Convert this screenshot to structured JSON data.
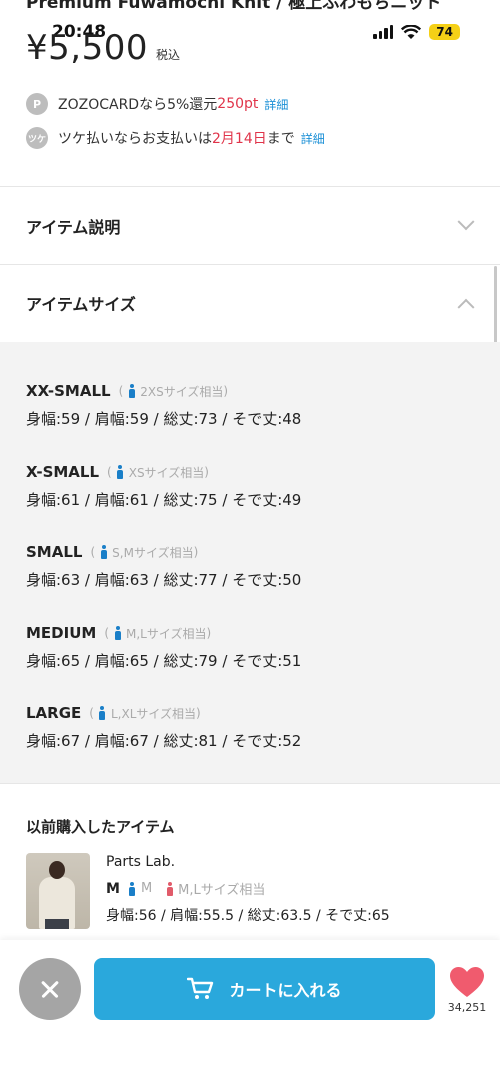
{
  "status_bar": {
    "time": "20:48",
    "battery": "74"
  },
  "product": {
    "title_cut": "Premium Fuwamochi Knit / 極上ふわもちニット",
    "price": "¥5,500",
    "tax_label": "税込"
  },
  "promos": [
    {
      "icon": "P",
      "text_pre": "ZOZOCARDなら5%還元 ",
      "highlight": "250pt",
      "text_post": "",
      "link": "詳細"
    },
    {
      "icon": "ツケ",
      "text_pre": "ツケ払いならお支払いは",
      "highlight": "2月14日",
      "text_post": "まで",
      "link": "詳細"
    }
  ],
  "accordions": {
    "description": "アイテム説明",
    "sizes": "アイテムサイズ"
  },
  "sizes": [
    {
      "name": "XX-SMALL",
      "note": "2XSサイズ相当",
      "dims": "身幅:59 / 肩幅:59 / 総丈:73 / そで丈:48"
    },
    {
      "name": "X-SMALL",
      "note": "XSサイズ相当",
      "dims": "身幅:61 / 肩幅:61 / 総丈:75 / そで丈:49"
    },
    {
      "name": "SMALL",
      "note": "S,Mサイズ相当",
      "dims": "身幅:63 / 肩幅:63 / 総丈:77 / そで丈:50"
    },
    {
      "name": "MEDIUM",
      "note": "M,Lサイズ相当",
      "dims": "身幅:65 / 肩幅:65 / 総丈:79 / そで丈:51"
    },
    {
      "name": "LARGE",
      "note": "L,XLサイズ相当",
      "dims": "身幅:67 / 肩幅:67 / 総丈:81 / そで丈:52"
    }
  ],
  "previous": {
    "title": "以前購入したアイテム",
    "brand": "Parts Lab.",
    "size": "M",
    "male_size": "M",
    "female_size": "M,Lサイズ相当",
    "dims": "身幅:56 / 肩幅:55.5 / 総丈:63.5 / そで丈:65"
  },
  "bottom": {
    "cart_label": "カートに入れる",
    "fav_count": "34,251"
  },
  "colors": {
    "accent_blue": "#2aa8dc",
    "price_red": "#e0344a",
    "link_blue": "#1a8fd6",
    "heart": "#f05b6e"
  }
}
